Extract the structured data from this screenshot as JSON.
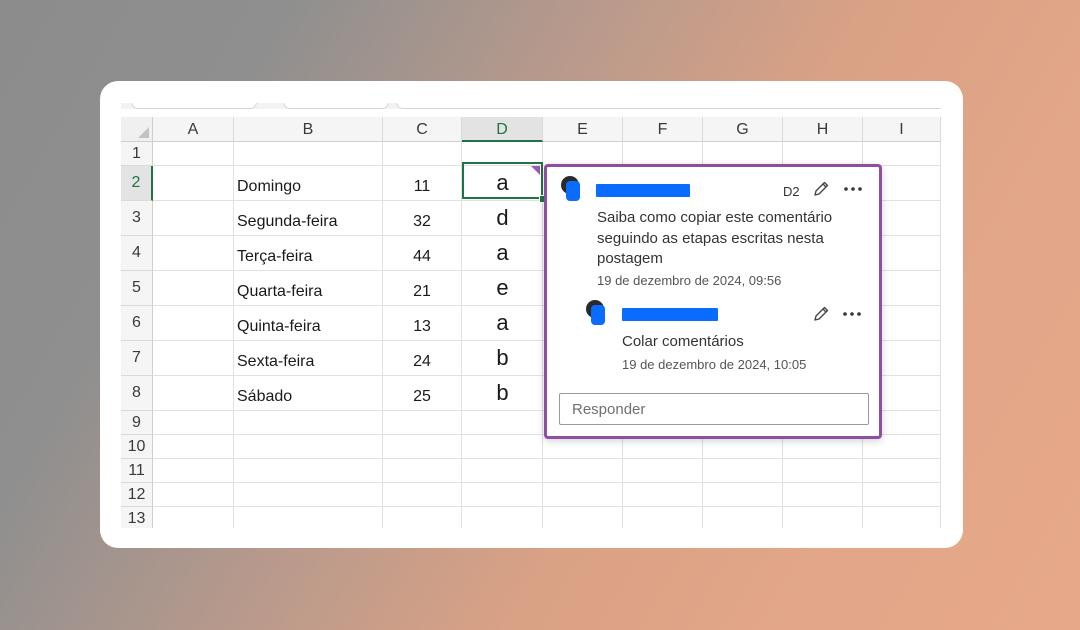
{
  "columns": [
    "A",
    "B",
    "C",
    "D",
    "E",
    "F",
    "G",
    "H",
    "I"
  ],
  "rows": [
    "1",
    "2",
    "3",
    "4",
    "5",
    "6",
    "7",
    "8",
    "9",
    "10",
    "11",
    "12",
    "13"
  ],
  "cells": [
    {
      "day": "",
      "value": "",
      "letter": ""
    },
    {
      "day": "Domingo",
      "value": "11",
      "letter": "a"
    },
    {
      "day": "Segunda-feira",
      "value": "32",
      "letter": "d"
    },
    {
      "day": "Terça-feira",
      "value": "44",
      "letter": "a"
    },
    {
      "day": "Quarta-feira",
      "value": "21",
      "letter": "e"
    },
    {
      "day": "Quinta-feira",
      "value": "13",
      "letter": "a"
    },
    {
      "day": "Sexta-feira",
      "value": "24",
      "letter": "b"
    },
    {
      "day": "Sábado",
      "value": "25",
      "letter": "b"
    }
  ],
  "comment": {
    "cell_ref": "D2",
    "text": "Saiba como copiar este comentário seguindo as etapas escritas nesta postagem",
    "timestamp": "19 de dezembro de 2024, 09:56",
    "reply": {
      "text": "Colar comentários",
      "timestamp": "19 de dezembro de 2024, 10:05"
    },
    "reply_placeholder": "Responder",
    "icons": {
      "edit": "pencil-icon",
      "more": "more-options-icon",
      "avatar": "user-avatar-icon"
    }
  },
  "colors": {
    "accent": "#217346",
    "comment_border": "#8e4fa0",
    "redaction": "#0a6cff"
  }
}
